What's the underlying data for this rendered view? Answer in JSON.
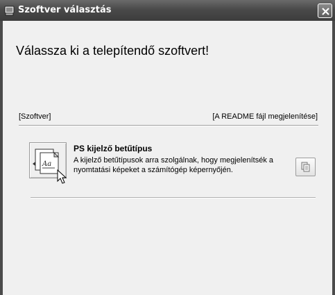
{
  "window": {
    "title": "Szoftver választás"
  },
  "main": {
    "heading": "Válassza ki a telepítendő szoftvert!",
    "column_software": "[Szoftver]",
    "column_readme": "[A README fájl megjelenítése]"
  },
  "software_items": [
    {
      "name": "PS kijelző betűtípus",
      "description": "A kijelző betűtípusok arra szolgálnak, hogy megjelenítsék a nyomtatási képeket a számítógép képernyőjén.",
      "icon": "font-document-icon",
      "readme_icon": "documents-icon"
    }
  ]
}
